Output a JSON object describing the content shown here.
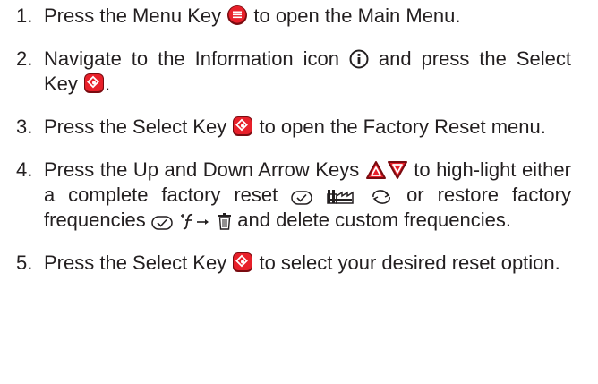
{
  "steps": [
    {
      "num": "1.",
      "parts": [
        "Press the Menu Key",
        "to open the Main Menu."
      ]
    },
    {
      "num": "2.",
      "parts": [
        "Navigate to the Information icon",
        "and press the Select Key",
        "."
      ]
    },
    {
      "num": "3.",
      "parts": [
        "Press the Select Key",
        "to open the Factory Reset menu."
      ]
    },
    {
      "num": "4.",
      "parts": [
        "Press the Up and Down Arrow Keys",
        "to high-light either a complete factory reset",
        "or restore factory frequencies",
        "and delete custom frequencies."
      ]
    },
    {
      "num": "5.",
      "parts": [
        "Press the Select Key",
        "to select your desired reset option."
      ]
    }
  ],
  "icons": {
    "menu_key": "menu-key-icon",
    "info": "information-icon",
    "select_key": "select-key-icon",
    "up_arrow": "up-arrow-key-icon",
    "down_arrow": "down-arrow-key-icon",
    "check_box": "checkmark-icon",
    "factory": "factory-icon",
    "reset_cycle": "reset-cycle-icon",
    "frequency": "custom-frequency-icon",
    "trash": "trash-icon"
  },
  "colors": {
    "text": "#231f20",
    "key_red": "#e8202a",
    "key_dark": "#7a0b10"
  }
}
